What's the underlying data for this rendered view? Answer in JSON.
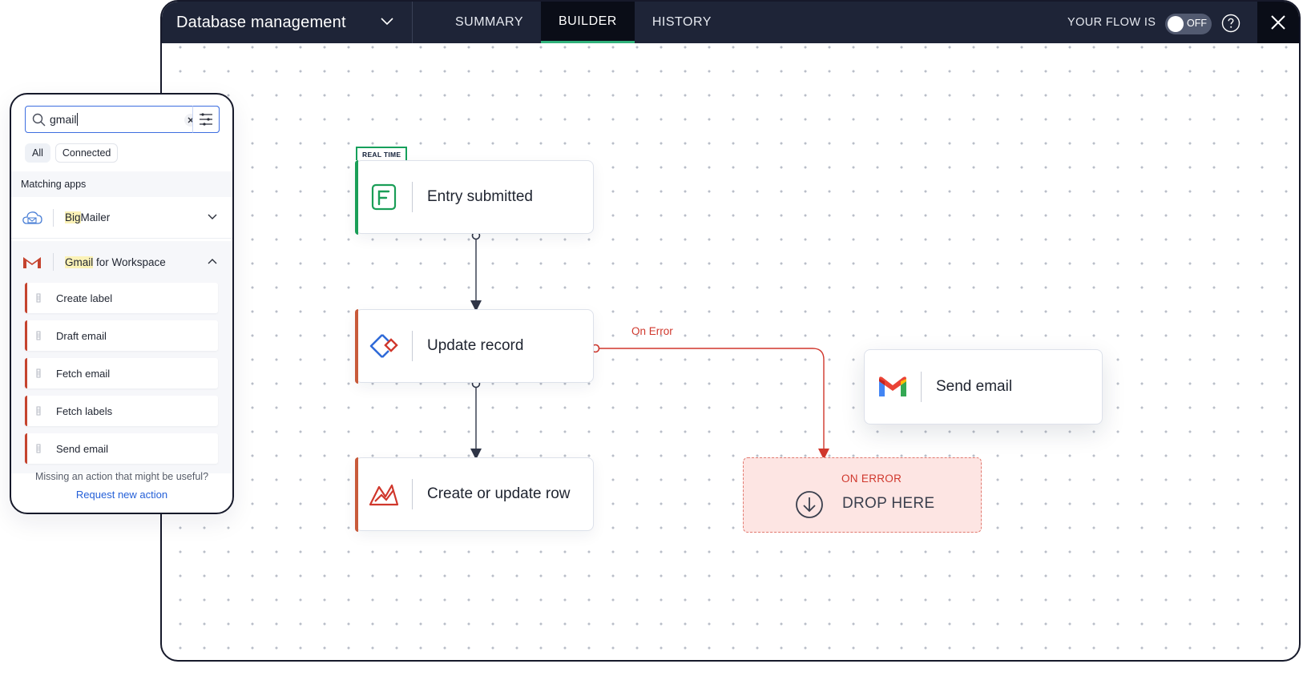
{
  "header": {
    "title": "Database management",
    "tabs": [
      {
        "label": "SUMMARY",
        "active": false
      },
      {
        "label": "BUILDER",
        "active": true
      },
      {
        "label": "HISTORY",
        "active": false
      }
    ],
    "flow_label": "YOUR FLOW IS",
    "toggle_text": "OFF",
    "toggle_on": false,
    "help_icon": "question-circle-icon",
    "close_icon": "close-icon"
  },
  "canvas": {
    "trigger_badge": "REAL TIME",
    "nodes": [
      {
        "label": "Entry submitted",
        "icon": "forms-app-icon",
        "accent": "#1a9e57"
      },
      {
        "label": "Update record",
        "icon": "creator-app-icon",
        "accent": "#c85a3a"
      },
      {
        "label": "Create or update row",
        "icon": "sheet-analytics-icon",
        "accent": "#c85a3a"
      },
      {
        "label": "Send email",
        "icon": "gmail-icon",
        "accent": ""
      }
    ],
    "on_error_edge_label": "On Error",
    "drop_zone": {
      "title": "ON ERROR",
      "text": "DROP HERE",
      "icon": "download-circle-icon"
    }
  },
  "panel": {
    "search": {
      "value": "gmail",
      "icon": "search-icon",
      "clear_icon": "clear-icon",
      "filter_icon": "filter-icon"
    },
    "filters": [
      "All",
      "Connected"
    ],
    "active_filter": "All",
    "section_title": "Matching apps",
    "apps": [
      {
        "name_highlight": "Big",
        "name_rest": "Mailer",
        "icon": "cloud-mail-icon",
        "expanded": false
      },
      {
        "name_highlight": "Gmail",
        "name_rest": " for Workspace",
        "icon": "gmail-icon",
        "expanded": true
      }
    ],
    "actions": [
      "Create label",
      "Draft email",
      "Fetch email",
      "Fetch labels",
      "Send email"
    ],
    "missing_text": "Missing an action that might be useful?",
    "request_link": "Request new action"
  },
  "colors": {
    "header_bg": "#1e2437",
    "active_tab_underline": "#2fb17a",
    "error_red": "#d0372c",
    "trigger_green": "#1a9e57",
    "link_blue": "#2560d8"
  }
}
